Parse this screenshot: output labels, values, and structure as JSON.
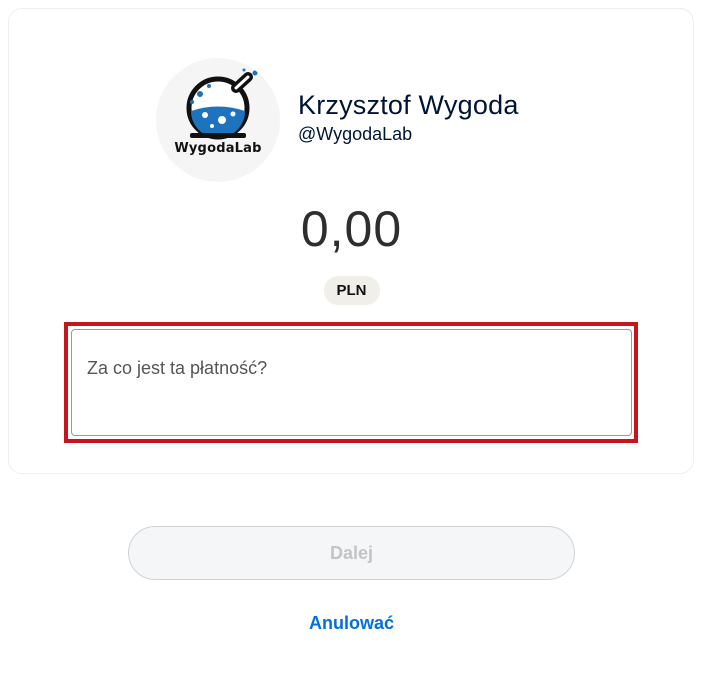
{
  "profile": {
    "logo_text": "WygodaLab",
    "name": "Krzysztof Wygoda",
    "handle": "@WygodaLab"
  },
  "payment": {
    "amount": "0,00",
    "currency": "PLN",
    "note_placeholder": "Za co jest ta płatność?",
    "note_value": ""
  },
  "actions": {
    "next_label": "Dalej",
    "cancel_label": "Anulować"
  },
  "colors": {
    "highlight_border": "#c4161c",
    "link": "#0070e0",
    "flask_liquid": "#1e73be",
    "name_text": "#001435"
  }
}
